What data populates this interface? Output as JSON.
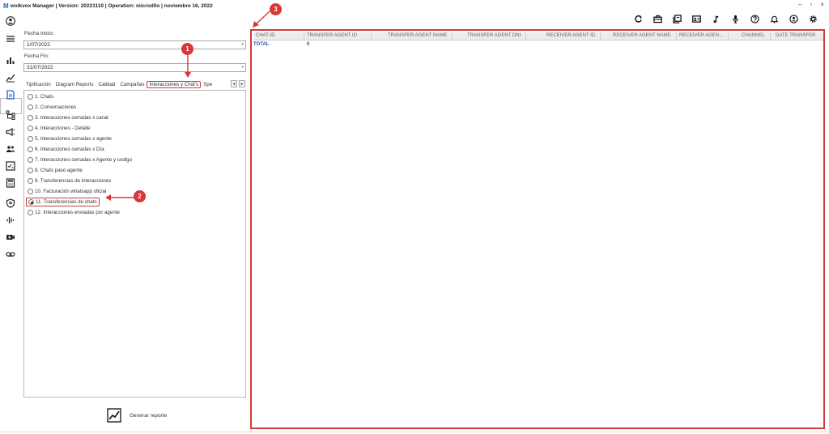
{
  "window": {
    "app_logo": "M",
    "title": "wolkvox Manager  | Version: 20221110 |  Operation: microdllo | noviembre 16, 2022",
    "controls": [
      "–",
      "▫",
      "×"
    ]
  },
  "toolbar_icons": [
    "refresh-icon",
    "briefcase-icon",
    "book-icon",
    "id-card-icon",
    "music-note-icon",
    "microphone-icon",
    "help-icon",
    "bell-icon",
    "user-icon",
    "settings-icon"
  ],
  "nav_icons": [
    "avatar-icon",
    "menu-icon",
    "bar-chart-icon",
    "analytics-icon",
    "reports-icon",
    "hierarchy-icon",
    "campaign-icon",
    "agents-icon",
    "checklist-icon",
    "calculator-icon",
    "security-icon",
    "audio-wave-icon",
    "video-add-icon",
    "voicemail-icon"
  ],
  "filters": {
    "start_label": "Fecha Inicio:",
    "start_value": "1/07/2022",
    "end_label": "Fecha Fin:",
    "end_value": "31/07/2022"
  },
  "tabs": [
    "Tipificación",
    "Diagram Reports",
    "Calidad",
    "Campañas",
    "Interacciones y Chat's",
    "Spe"
  ],
  "active_tab": "Interacciones y Chat's",
  "reports": [
    "1. Chats",
    "2. Conversaciones",
    "3. Interacciones cerradas x canal",
    "4. Interacciones - Detalle",
    "5. Interacciones cerradas x agente",
    "6. Interacciones cerradas x Día",
    "7. Interacciones cerradas x Agente y codigo",
    "8. Chats paso agente",
    "9. Transferencias de interacciones",
    "10. Facturación whatsapp oficial",
    "11. Transferencias de chats",
    "12. Interacciones enviadas por agente"
  ],
  "selected_report": "11. Transferencias de chats",
  "generate_label": "Generar reporte",
  "callouts": [
    "1",
    "2",
    "3"
  ],
  "grid": {
    "columns": [
      "CHAT-ID",
      "TRANSFER AGENT ID",
      "TRANSFER AGENT NAME",
      "TRANSFER AGENT DNI",
      "RECEIVER AGENT ID",
      "RECEIVER AGENT NAME",
      "RECEIVER AGEN...",
      "CHANNEL",
      "DATE TRANSFER"
    ],
    "total_label": "TOTAL",
    "total_value": "0"
  },
  "colors": {
    "highlight": "#d23a3a",
    "link": "#1e5aa8"
  }
}
